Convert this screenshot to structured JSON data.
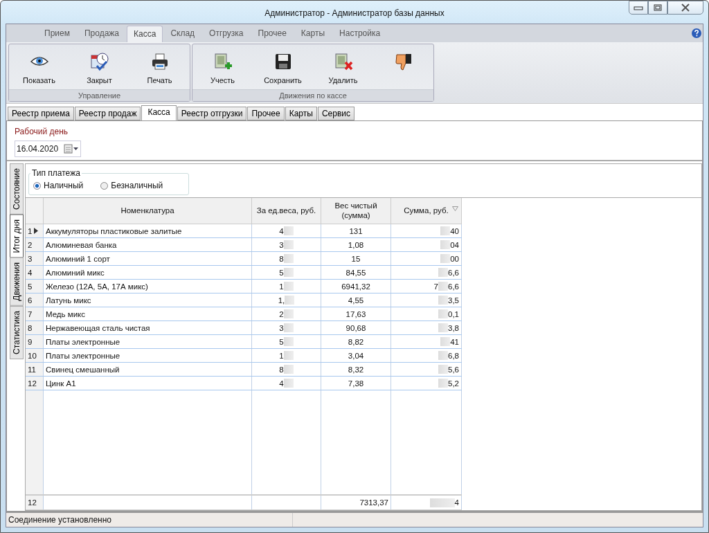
{
  "window": {
    "title": "Администратор - Администратор базы данных"
  },
  "ribbon_tabs": [
    {
      "label": "Прием",
      "selected": false
    },
    {
      "label": "Продажа",
      "selected": false
    },
    {
      "label": "Касса",
      "selected": true
    },
    {
      "label": "Склад",
      "selected": false
    },
    {
      "label": "Отгрузка",
      "selected": false
    },
    {
      "label": "Прочее",
      "selected": false
    },
    {
      "label": "Карты",
      "selected": false
    },
    {
      "label": "Настройка",
      "selected": false
    }
  ],
  "ribbon_groups": [
    {
      "title": "Управление",
      "buttons": [
        {
          "label": "Показать",
          "kind": "eye"
        },
        {
          "label": "Закрыт",
          "kind": "calendar"
        },
        {
          "label": "Печать",
          "kind": "printer"
        }
      ]
    },
    {
      "title": "Движения по кассе",
      "buttons": [
        {
          "label": "Учесть",
          "kind": "add"
        },
        {
          "label": "Сохранить",
          "kind": "save"
        },
        {
          "label": "Удалить",
          "kind": "delete"
        },
        {
          "kind": "thumb"
        }
      ]
    }
  ],
  "doc_tabs": [
    {
      "label": "Реестр приема",
      "selected": false
    },
    {
      "label": "Реестр продаж",
      "selected": false
    },
    {
      "label": "Касса",
      "selected": true
    },
    {
      "label": "Реестр отгрузки",
      "selected": false
    },
    {
      "label": "Прочее",
      "selected": false
    },
    {
      "label": "Карты",
      "selected": false
    },
    {
      "label": "Сервис",
      "selected": false
    }
  ],
  "workday": {
    "label": "Рабочий день",
    "value": "16.04.2020"
  },
  "side_tabs": [
    {
      "label": "Состояние",
      "selected": false
    },
    {
      "label": "Итог дня",
      "selected": true
    },
    {
      "label": "Движения",
      "selected": false
    },
    {
      "label": "Статистика",
      "selected": false
    }
  ],
  "payment_type": {
    "title": "Тип платежа",
    "options": [
      {
        "label": "Наличный",
        "selected": true
      },
      {
        "label": "Безналичный",
        "selected": false
      }
    ]
  },
  "table": {
    "columns": [
      "Номенклатура",
      "За ед.веса, руб.",
      "Вес чистый (сумма)",
      "Сумма, руб."
    ],
    "rows": [
      {
        "n": "1",
        "current": true,
        "name": "Аккумуляторы пластиковые залитые",
        "price": "4",
        "weight": "131",
        "sum_tail": "40"
      },
      {
        "n": "2",
        "current": false,
        "name": "Алюминевая банка",
        "price": "3",
        "weight": "1,08",
        "sum_tail": "04"
      },
      {
        "n": "3",
        "current": false,
        "name": "Алюминий 1 сорт",
        "price": "8",
        "weight": "15",
        "sum_tail": "00"
      },
      {
        "n": "4",
        "current": false,
        "name": "Алюминий микс",
        "price": "5",
        "weight": "84,55",
        "sum_tail": "6,6"
      },
      {
        "n": "5",
        "current": false,
        "name": "Железо (12А, 5А, 17А микс)",
        "price": "1",
        "weight": "6941,32",
        "sum_lead": "7",
        "sum_tail": "6,6"
      },
      {
        "n": "6",
        "current": false,
        "name": "Латунь микс",
        "price": "1,",
        "weight": "4,55",
        "sum_tail": "3,5"
      },
      {
        "n": "7",
        "current": false,
        "name": "Медь микс",
        "price": "2",
        "weight": "17,63",
        "sum_tail": "0,1"
      },
      {
        "n": "8",
        "current": false,
        "name": "Нержавеющая сталь чистая",
        "price": "3",
        "weight": "90,68",
        "sum_tail": "3,8"
      },
      {
        "n": "9",
        "current": false,
        "name": "Платы электронные",
        "price": "5",
        "weight": "8,82",
        "sum_tail": "41"
      },
      {
        "n": "10",
        "current": false,
        "name": "Платы электронные",
        "price": "1",
        "weight": "3,04",
        "sum_tail": "6,8"
      },
      {
        "n": "11",
        "current": false,
        "name": "Свинец смешанный",
        "price": "8",
        "weight": "8,32",
        "sum_tail": "5,6"
      },
      {
        "n": "12",
        "current": false,
        "name": "Цинк А1",
        "price": "4",
        "weight": "7,38",
        "sum_tail": "5,2"
      }
    ],
    "footer": {
      "count": "12",
      "weight": "7313,37",
      "sum_tail": "4"
    }
  },
  "status_bar": {
    "text": "Соединение установленно"
  }
}
